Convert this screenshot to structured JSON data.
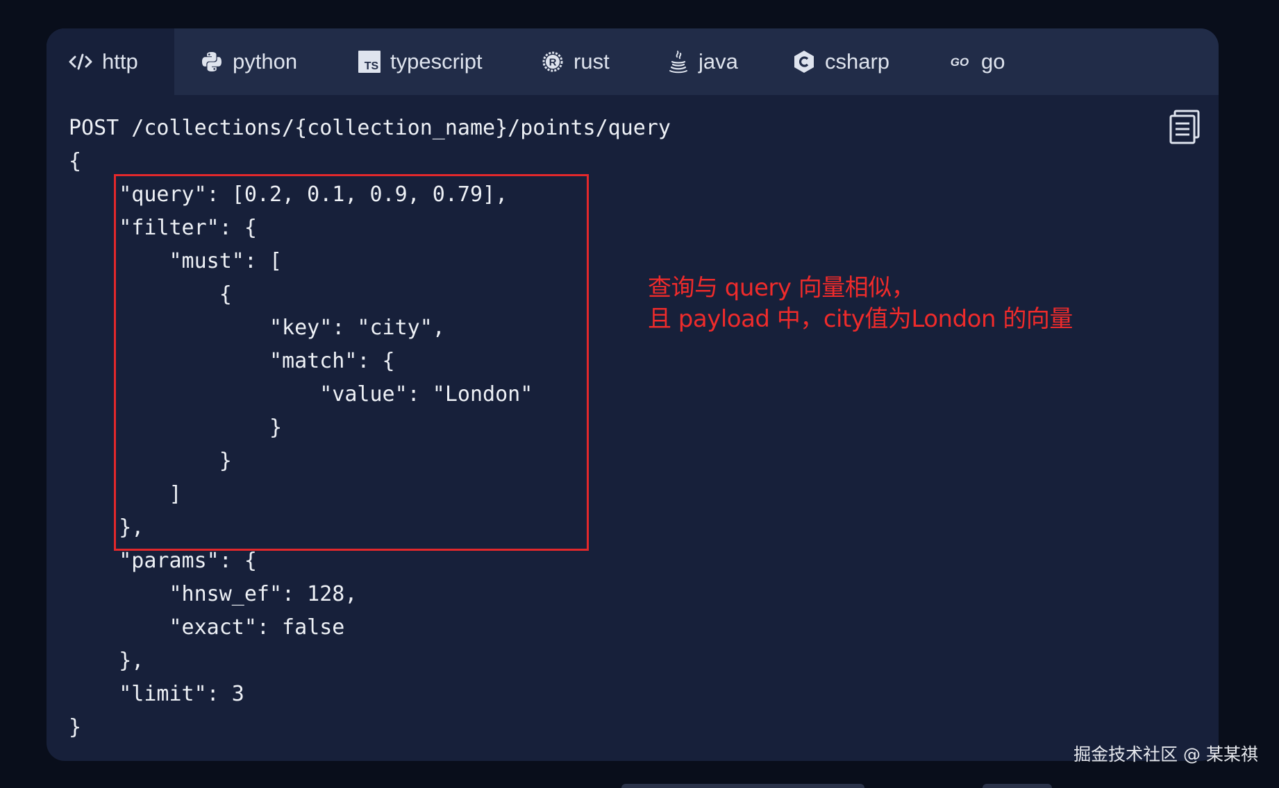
{
  "tabs": [
    {
      "label": "http",
      "icon": "code-icon",
      "active": true
    },
    {
      "label": "python",
      "icon": "python-icon",
      "active": false
    },
    {
      "label": "typescript",
      "icon": "typescript-icon",
      "active": false
    },
    {
      "label": "rust",
      "icon": "rust-icon",
      "active": false
    },
    {
      "label": "java",
      "icon": "java-icon",
      "active": false
    },
    {
      "label": "csharp",
      "icon": "csharp-icon",
      "active": false
    },
    {
      "label": "go",
      "icon": "go-icon",
      "active": false
    }
  ],
  "code": {
    "lines": [
      "POST /collections/{collection_name}/points/query",
      "{",
      "    \"query\": [0.2, 0.1, 0.9, 0.79],",
      "    \"filter\": {",
      "        \"must\": [",
      "            {",
      "                \"key\": \"city\",",
      "                \"match\": {",
      "                    \"value\": \"London\"",
      "                }",
      "            }",
      "        ]",
      "    },",
      "    \"params\": {",
      "        \"hnsw_ef\": 128,",
      "        \"exact\": false",
      "    },",
      "    \"limit\": 3",
      "}"
    ]
  },
  "annotation": {
    "line1": "查询与 query 向量相似，",
    "line2": "且 payload 中，city值为London 的向量"
  },
  "watermark": "掘金技术社区 @ 某某祺",
  "colors": {
    "page_bg": "#090e1b",
    "panel_bg": "#17203a",
    "tabbar_bg": "#212c48",
    "highlight": "#e3282b",
    "annotation": "#ef2b2b"
  },
  "copy_icon": "copy-icon"
}
